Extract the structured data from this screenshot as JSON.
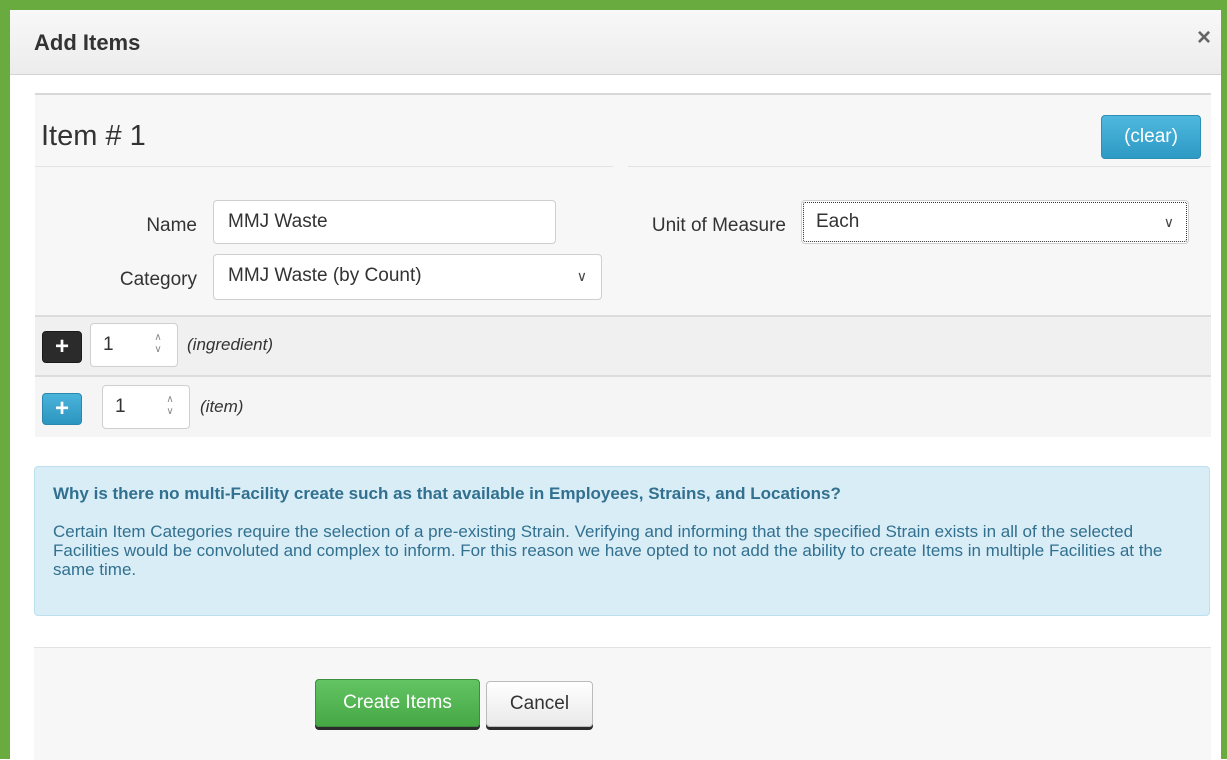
{
  "dialog": {
    "title": "Add Items",
    "close_glyph": "×"
  },
  "item": {
    "heading": "Item # 1",
    "clear_label": "(clear)",
    "name_label": "Name",
    "name_value": "MMJ Waste",
    "category_label": "Category",
    "category_value": "MMJ Waste (by Count)",
    "uom_label": "Unit of Measure",
    "uom_value": "Each"
  },
  "ingredient_row": {
    "count": "1",
    "hint": "(ingredient)"
  },
  "item_row": {
    "count": "1",
    "hint": "(item)"
  },
  "info": {
    "title": "Why is there no multi-Facility create such as that available in Employees, Strains, and Locations?",
    "body": "Certain Item Categories require the selection of a pre-existing Strain. Verifying and informing that the specified Strain exists in all of the selected Facilities would be convoluted and complex to inform. For this reason we have opted to not add the ability to create Items in multiple Facilities at the same time."
  },
  "footer": {
    "create_label": "Create Items",
    "cancel_label": "Cancel"
  },
  "colors": {
    "frame": "#6aab3f",
    "primary_info": "#2d9ac4",
    "success": "#45a845",
    "info_bg": "#d9edf7",
    "info_text": "#31708f"
  },
  "icons": {
    "close": "close-icon",
    "plus": "plus-icon",
    "chevron": "chevron-down-icon",
    "spinner": "spinner-icon"
  }
}
